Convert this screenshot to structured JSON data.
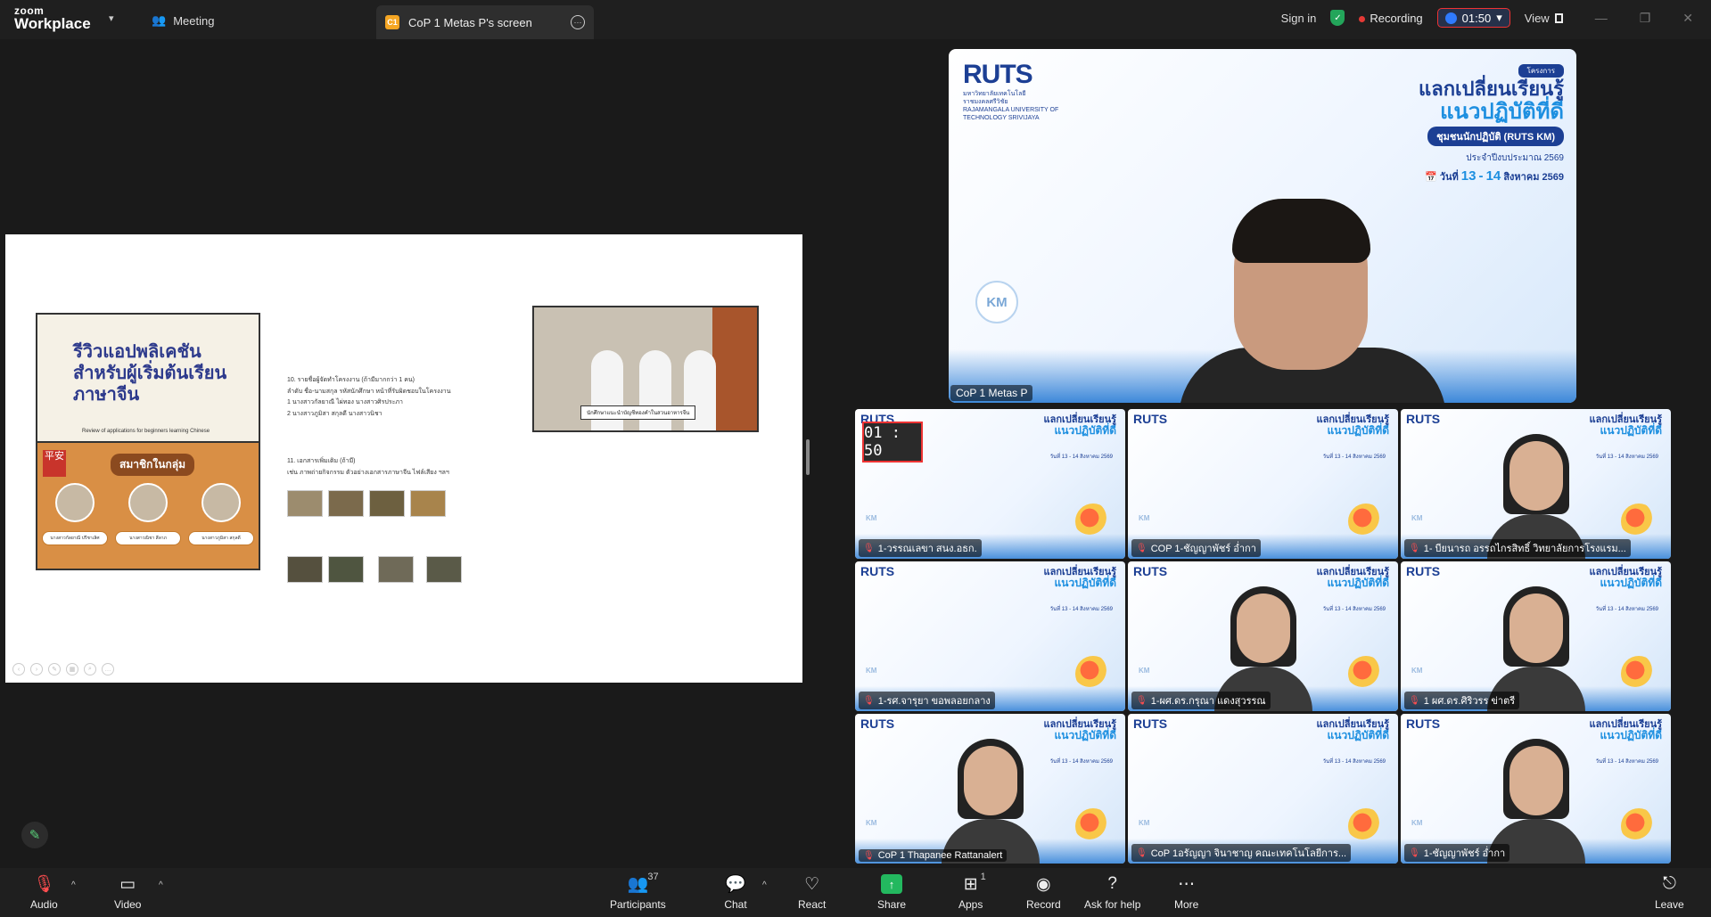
{
  "topbar": {
    "logo_line1": "zoom",
    "logo_line2": "Workplace",
    "meeting_tab": "Meeting",
    "share_tab_badge": "C1",
    "share_tab_label": "CoP 1 Metas P's screen",
    "signin": "Sign in",
    "recording": "Recording",
    "timer": "01:50",
    "view": "View"
  },
  "slide": {
    "poster_title": "รีวิวแอปพลิเคชันสำหรับผู้เริ่มต้นเรียนภาษาจีน",
    "poster_subtitle": "Review of applications for beginners learning Chinese",
    "poster_seal": "平安",
    "poster_group": "สมาชิกในกลุ่ม",
    "members": [
      "นางสาวกัลยาณี ปรีชาเลิศ",
      "นางสาวณิชา สีลาภ",
      "นางสาวภูมิสา สกุลดี"
    ],
    "section10": "10. รายชื่อผู้จัดทำโครงงาน (ถ้ามีมากกว่า 1 คน)",
    "section10_sub": "ลำดับ ชื่อ-นามสกุล รหัสนักศึกษา หน้าที่รับผิดชอบในโครงงาน",
    "section10_r1": "1  นางสาวกัลยาณี  ไผ่ทอง  นางสาวศิรประภา",
    "section10_r2": "2  นางสาวภูมิสา  สกุลดี  นางสาวนิชา",
    "section11": "11. เอกสารเพิ่มเติม (ถ้ามี)",
    "section11_sub": "เช่น ภาพถ่ายกิจกรรม ตัวอย่างเอกสารภาษาจีน ไฟล์เสียง ฯลฯ",
    "video_caption": "นักศึกษาแนะนำบัญชีทองคำในสวนอาหารจีน"
  },
  "speaker": {
    "logo": "RUTS",
    "uni_line1": "มหาวิทยาลัยเทคโนโลยี",
    "uni_line2": "ราชมงคลศรีวิชัย",
    "uni_line3": "RAJAMANGALA UNIVERSITY OF",
    "uni_line4": "TECHNOLOGY SRIVIJAYA",
    "project": "โครงการ",
    "title1": "แลกเปลี่ยนเรียนรู้",
    "title2": "แนวปฏิบัติที่ดี",
    "title3": "ชุมชนนักปฏิบัติ (RUTS KM)",
    "budget": "ประจำปีงบประมาณ 2569",
    "date_prefix": "วันที่",
    "date_day1": "13",
    "date_dash": "-",
    "date_day2": "14",
    "date_month": "สิงหาคม 2569",
    "km": "KM",
    "name": "CoP 1 Metas P"
  },
  "tiles": [
    {
      "name": "1-วรรณเลขา  สนง.อธก.",
      "clock": "01 : 50"
    },
    {
      "name": "COP 1-ชัญญาพัชร์ อ่ำกา"
    },
    {
      "name": "1- บียนารถ อรรถไกรสิทธิ์ วิทยาลัยการโรงแรม..."
    },
    {
      "name": "1-รศ.จารุยา ขอพลอยกลาง"
    },
    {
      "name": "1-ผศ.ดร.กรุณา แดงสุวรรณ"
    },
    {
      "name": "1 ผศ.ดร.ศิริวรร ข่าตรี"
    },
    {
      "name": "CoP 1 Thapanee Rattanalert"
    },
    {
      "name": "CoP 1อรัญญา จินาชาญ คณะเทคโนโลยีการ..."
    },
    {
      "name": "1-ชัญญาพัชร์ อ่ำกา"
    }
  ],
  "tile_bg": {
    "logo": "RUTS",
    "title1": "แลกเปลี่ยนเรียนรู้",
    "title2": "แนวปฏิบัติที่ดี",
    "date": "วันที่ 13 - 14 สิงหาคม 2569",
    "km": "KM"
  },
  "toolbar": {
    "audio": "Audio",
    "video": "Video",
    "participants": "Participants",
    "participants_count": "37",
    "chat": "Chat",
    "react": "React",
    "share": "Share",
    "apps": "Apps",
    "apps_count": "1",
    "record": "Record",
    "ask_for_help": "Ask for help",
    "more": "More",
    "leave": "Leave"
  },
  "colors": {
    "accent": "#23b85f",
    "recording": "#e53935",
    "leave": "#ff4d4f",
    "brand_blue": "#1c3f94"
  }
}
